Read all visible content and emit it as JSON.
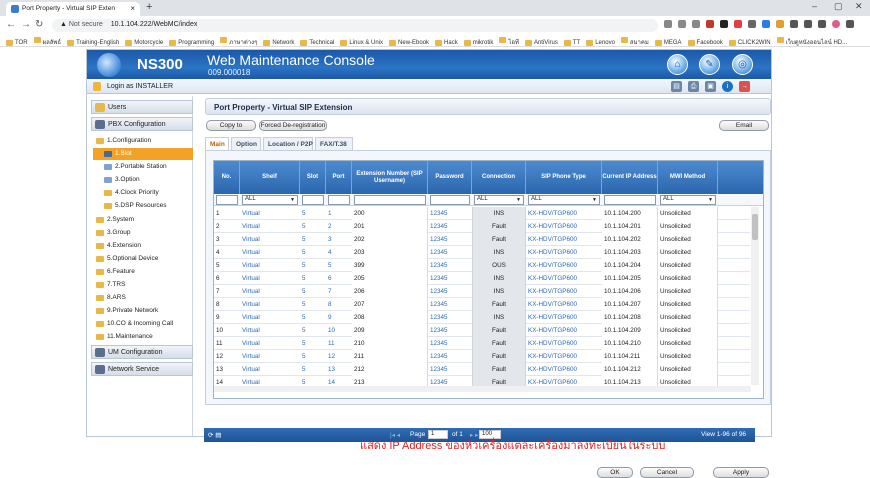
{
  "browser": {
    "tab_title": "Port Property - Virtual SIP Exten",
    "new_tab": "+",
    "close": "×",
    "not_secure": "Not secure",
    "url": "10.1.104.222/WebMC/index",
    "bookmarks": [
      "TOR",
      "ผลลัพธ์",
      "Training-English",
      "Motorcycle",
      "Programming",
      "ภาษาต่างๆ",
      "Network",
      "Technical",
      "Linux & Unix",
      "New-Ebook",
      "Hack",
      "mikrotik",
      "ไอที",
      "AntiVirus",
      "TT",
      "Lenovo",
      "สมาคม",
      "MEGA",
      "Facebook",
      "CLICK2WIN",
      "เว็บดูหนังออนไลน์ HD..."
    ]
  },
  "app": {
    "brand": "NS300",
    "title": "Web Maintenance Console",
    "version": "009.000018",
    "login_text": "Login as INSTALLER"
  },
  "sidebar": {
    "users": "Users",
    "pbx_configuration": "PBX Configuration",
    "configuration": "1.Configuration",
    "slot": "1.Slot",
    "portable_station": "2.Portable Station",
    "option": "3.Option",
    "clock_priority": "4.Clock Priority",
    "dsp_resources": "5.DSP Resources",
    "system": "2.System",
    "group": "3.Group",
    "extension": "4.Extension",
    "optional_device": "5.Optional Device",
    "feature": "6.Feature",
    "trs": "7.TRS",
    "ars": "8.ARS",
    "private_network": "9.Private Network",
    "co_incoming": "10.CO & Incoming Call",
    "maintenance": "11.Maintenance",
    "um_configuration": "UM Configuration",
    "network_service": "Network Service"
  },
  "main": {
    "page_title": "Port Property - Virtual SIP Extension",
    "copy_to": "Copy to",
    "forced_dereg": "Forced De-registration",
    "email": "Email",
    "tabs": [
      "Main",
      "Option",
      "Location / P2P",
      "FAX/T.38"
    ],
    "columns": [
      "No.",
      "Shelf",
      "Slot",
      "Port",
      "Extension Number (SIP Username)",
      "Password",
      "Connection",
      "SIP Phone Type",
      "Current IP Address",
      "MWI Method"
    ],
    "filters": {
      "shelf": "ALL",
      "connection": "ALL",
      "sip_phone_type": "ALL",
      "mwi": "ALL"
    },
    "rows": [
      [
        "1",
        "Virtual",
        "5",
        "1",
        "200",
        "12345",
        "INS",
        "KX-HDV/TGP600",
        "10.1.104.200",
        "Unsolicited"
      ],
      [
        "2",
        "Virtual",
        "5",
        "2",
        "201",
        "12345",
        "Fault",
        "KX-HDV/TGP600",
        "10.1.104.201",
        "Unsolicited"
      ],
      [
        "3",
        "Virtual",
        "5",
        "3",
        "202",
        "12345",
        "Fault",
        "KX-HDV/TGP600",
        "10.1.104.202",
        "Unsolicited"
      ],
      [
        "4",
        "Virtual",
        "5",
        "4",
        "203",
        "12345",
        "INS",
        "KX-HDV/TGP600",
        "10.1.104.203",
        "Unsolicited"
      ],
      [
        "5",
        "Virtual",
        "5",
        "5",
        "399",
        "12345",
        "OUS",
        "KX-HDV/TGP600",
        "10.1.104.204",
        "Unsolicited"
      ],
      [
        "6",
        "Virtual",
        "5",
        "6",
        "205",
        "12345",
        "INS",
        "KX-HDV/TGP600",
        "10.1.104.205",
        "Unsolicited"
      ],
      [
        "7",
        "Virtual",
        "5",
        "7",
        "206",
        "12345",
        "INS",
        "KX-HDV/TGP600",
        "10.1.104.206",
        "Unsolicited"
      ],
      [
        "8",
        "Virtual",
        "5",
        "8",
        "207",
        "12345",
        "Fault",
        "KX-HDV/TGP600",
        "10.1.104.207",
        "Unsolicited"
      ],
      [
        "9",
        "Virtual",
        "5",
        "9",
        "208",
        "12345",
        "INS",
        "KX-HDV/TGP600",
        "10.1.104.208",
        "Unsolicited"
      ],
      [
        "10",
        "Virtual",
        "5",
        "10",
        "209",
        "12345",
        "Fault",
        "KX-HDV/TGP600",
        "10.1.104.209",
        "Unsolicited"
      ],
      [
        "11",
        "Virtual",
        "5",
        "11",
        "210",
        "12345",
        "Fault",
        "KX-HDV/TGP600",
        "10.1.104.210",
        "Unsolicited"
      ],
      [
        "12",
        "Virtual",
        "5",
        "12",
        "211",
        "12345",
        "Fault",
        "KX-HDV/TGP600",
        "10.1.104.211",
        "Unsolicited"
      ],
      [
        "13",
        "Virtual",
        "5",
        "13",
        "212",
        "12345",
        "Fault",
        "KX-HDV/TGP600",
        "10.1.104.212",
        "Unsolicited"
      ],
      [
        "14",
        "Virtual",
        "5",
        "14",
        "213",
        "12345",
        "Fault",
        "KX-HDV/TGP600",
        "10.1.104.213",
        "Unsolicited"
      ]
    ],
    "pager": {
      "page_label": "Page",
      "page_value": "1",
      "of_label": "of 1",
      "page_size": "100",
      "view_text": "View 1-96 of 96"
    },
    "ok": "OK",
    "cancel": "Cancel",
    "apply": "Apply"
  },
  "caption": "แสดง IP Address ของหัวเครื่องแต่ละเครื่องมาลงทะเบียนในระบบ",
  "colors": {
    "banner": "#1b58a8",
    "active_item": "#f2a224",
    "header": "#2b66ad",
    "caption": "#e02020"
  }
}
